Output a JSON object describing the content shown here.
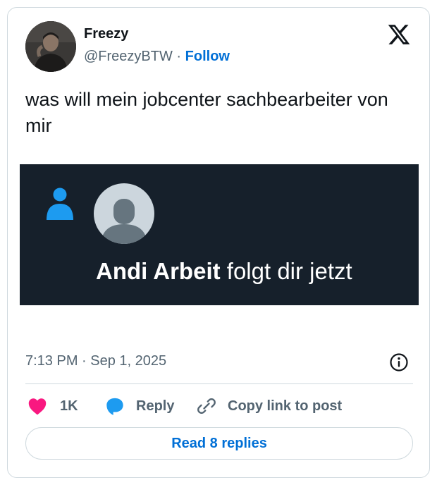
{
  "author": {
    "name": "Freezy",
    "handle": "@FreezyBTW",
    "separator": " · ",
    "follow_label": "Follow"
  },
  "tweet": {
    "text": "was will mein jobcenter sachbearbeiter von mir",
    "timestamp": "7:13 PM · Sep 1, 2025"
  },
  "media": {
    "notification_name": "Andi Arbeit",
    "notification_text": " folgt dir jetzt"
  },
  "actions": {
    "like_count": "1K",
    "reply_label": "Reply",
    "copy_link_label": "Copy link to post"
  },
  "read_replies_label": "Read 8 replies",
  "colors": {
    "link_blue": "#006fd6",
    "like_pink": "#f91880",
    "media_bg": "#16202b",
    "notification_blue": "#1d9bf0",
    "muted_text": "#536471"
  },
  "icons": [
    "x-logo-icon",
    "info-icon",
    "heart-icon",
    "reply-bubble-icon",
    "link-icon",
    "person-icon"
  ]
}
